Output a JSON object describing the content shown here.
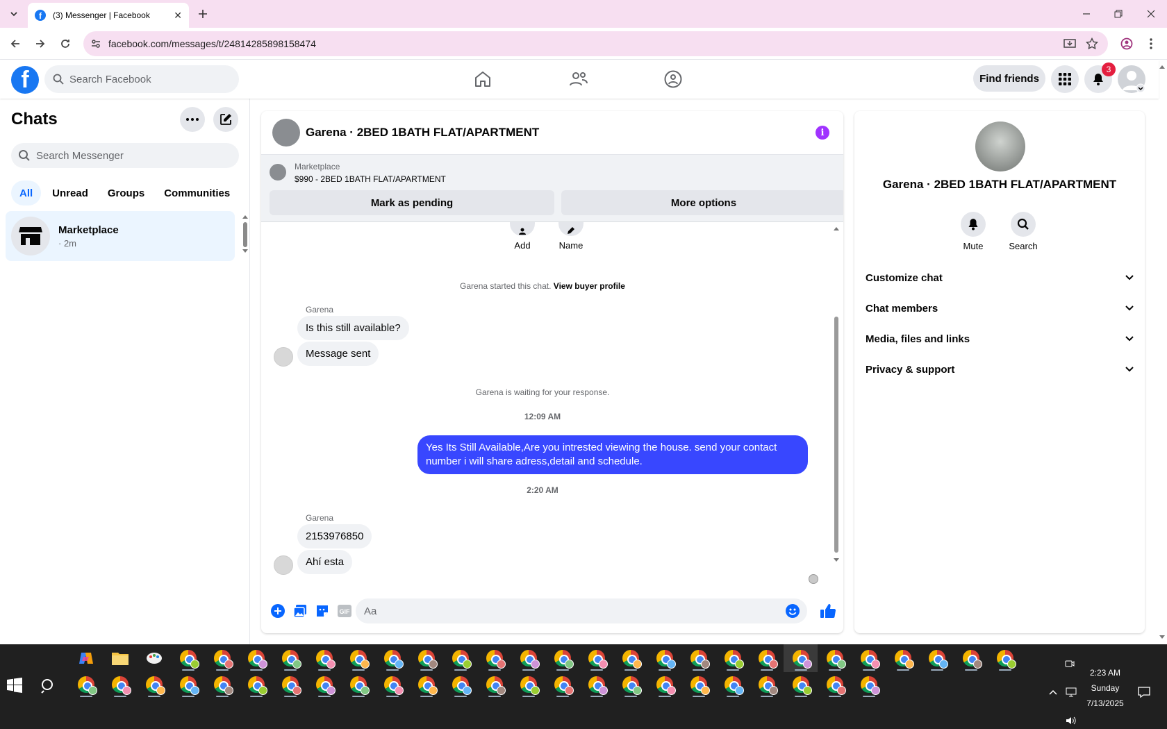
{
  "browser": {
    "tab_title": "(3) Messenger | Facebook",
    "url": "facebook.com/messages/t/24814285898158474"
  },
  "fb_header": {
    "search_placeholder": "Search Facebook",
    "find_friends": "Find friends",
    "notif_count": "3"
  },
  "chats_panel": {
    "title": "Chats",
    "search_placeholder": "Search Messenger",
    "filters": [
      "All",
      "Unread",
      "Groups",
      "Communities"
    ],
    "items": [
      {
        "name": "Marketplace",
        "sub": "· 2m"
      }
    ]
  },
  "conversation": {
    "title": "Garena · 2BED 1BATH FLAT/APARTMENT",
    "marketplace_label": "Marketplace",
    "listing": "$990 - 2BED 1BATH FLAT/APARTMENT",
    "mark_pending": "Mark as pending",
    "more_options": "More options",
    "actions": [
      "Add",
      "Name"
    ],
    "started_note": "Garena started this chat.",
    "buyer_profile_link": "View buyer profile",
    "sender1": "Garena",
    "msg1": "Is this still available?",
    "msg2": "Message sent",
    "waiting_note": "Garena is waiting for your response.",
    "time1": "12:09 AM",
    "outgoing": "Yes Its Still Available,Are you intrested viewing the house. send your contact number i will share adress,detail and schedule.",
    "time2": "2:20 AM",
    "sender2": "Garena",
    "msg3": "2153976850",
    "msg4": "Ahí esta",
    "composer_placeholder": "Aa"
  },
  "details_panel": {
    "name": "Garena · 2BED 1BATH FLAT/APARTMENT",
    "actions": [
      "Mute",
      "Search"
    ],
    "sections": [
      "Customize chat",
      "Chat members",
      "Media, files and links",
      "Privacy & support"
    ]
  },
  "taskbar": {
    "time": "2:23 AM",
    "day": "Sunday",
    "date": "7/13/2025"
  },
  "colors": {
    "fb_blue": "#1877f2",
    "outgoing_bubble": "#3847ff",
    "info_purple": "#a033ff",
    "tab_strip": "#f7dff1"
  }
}
